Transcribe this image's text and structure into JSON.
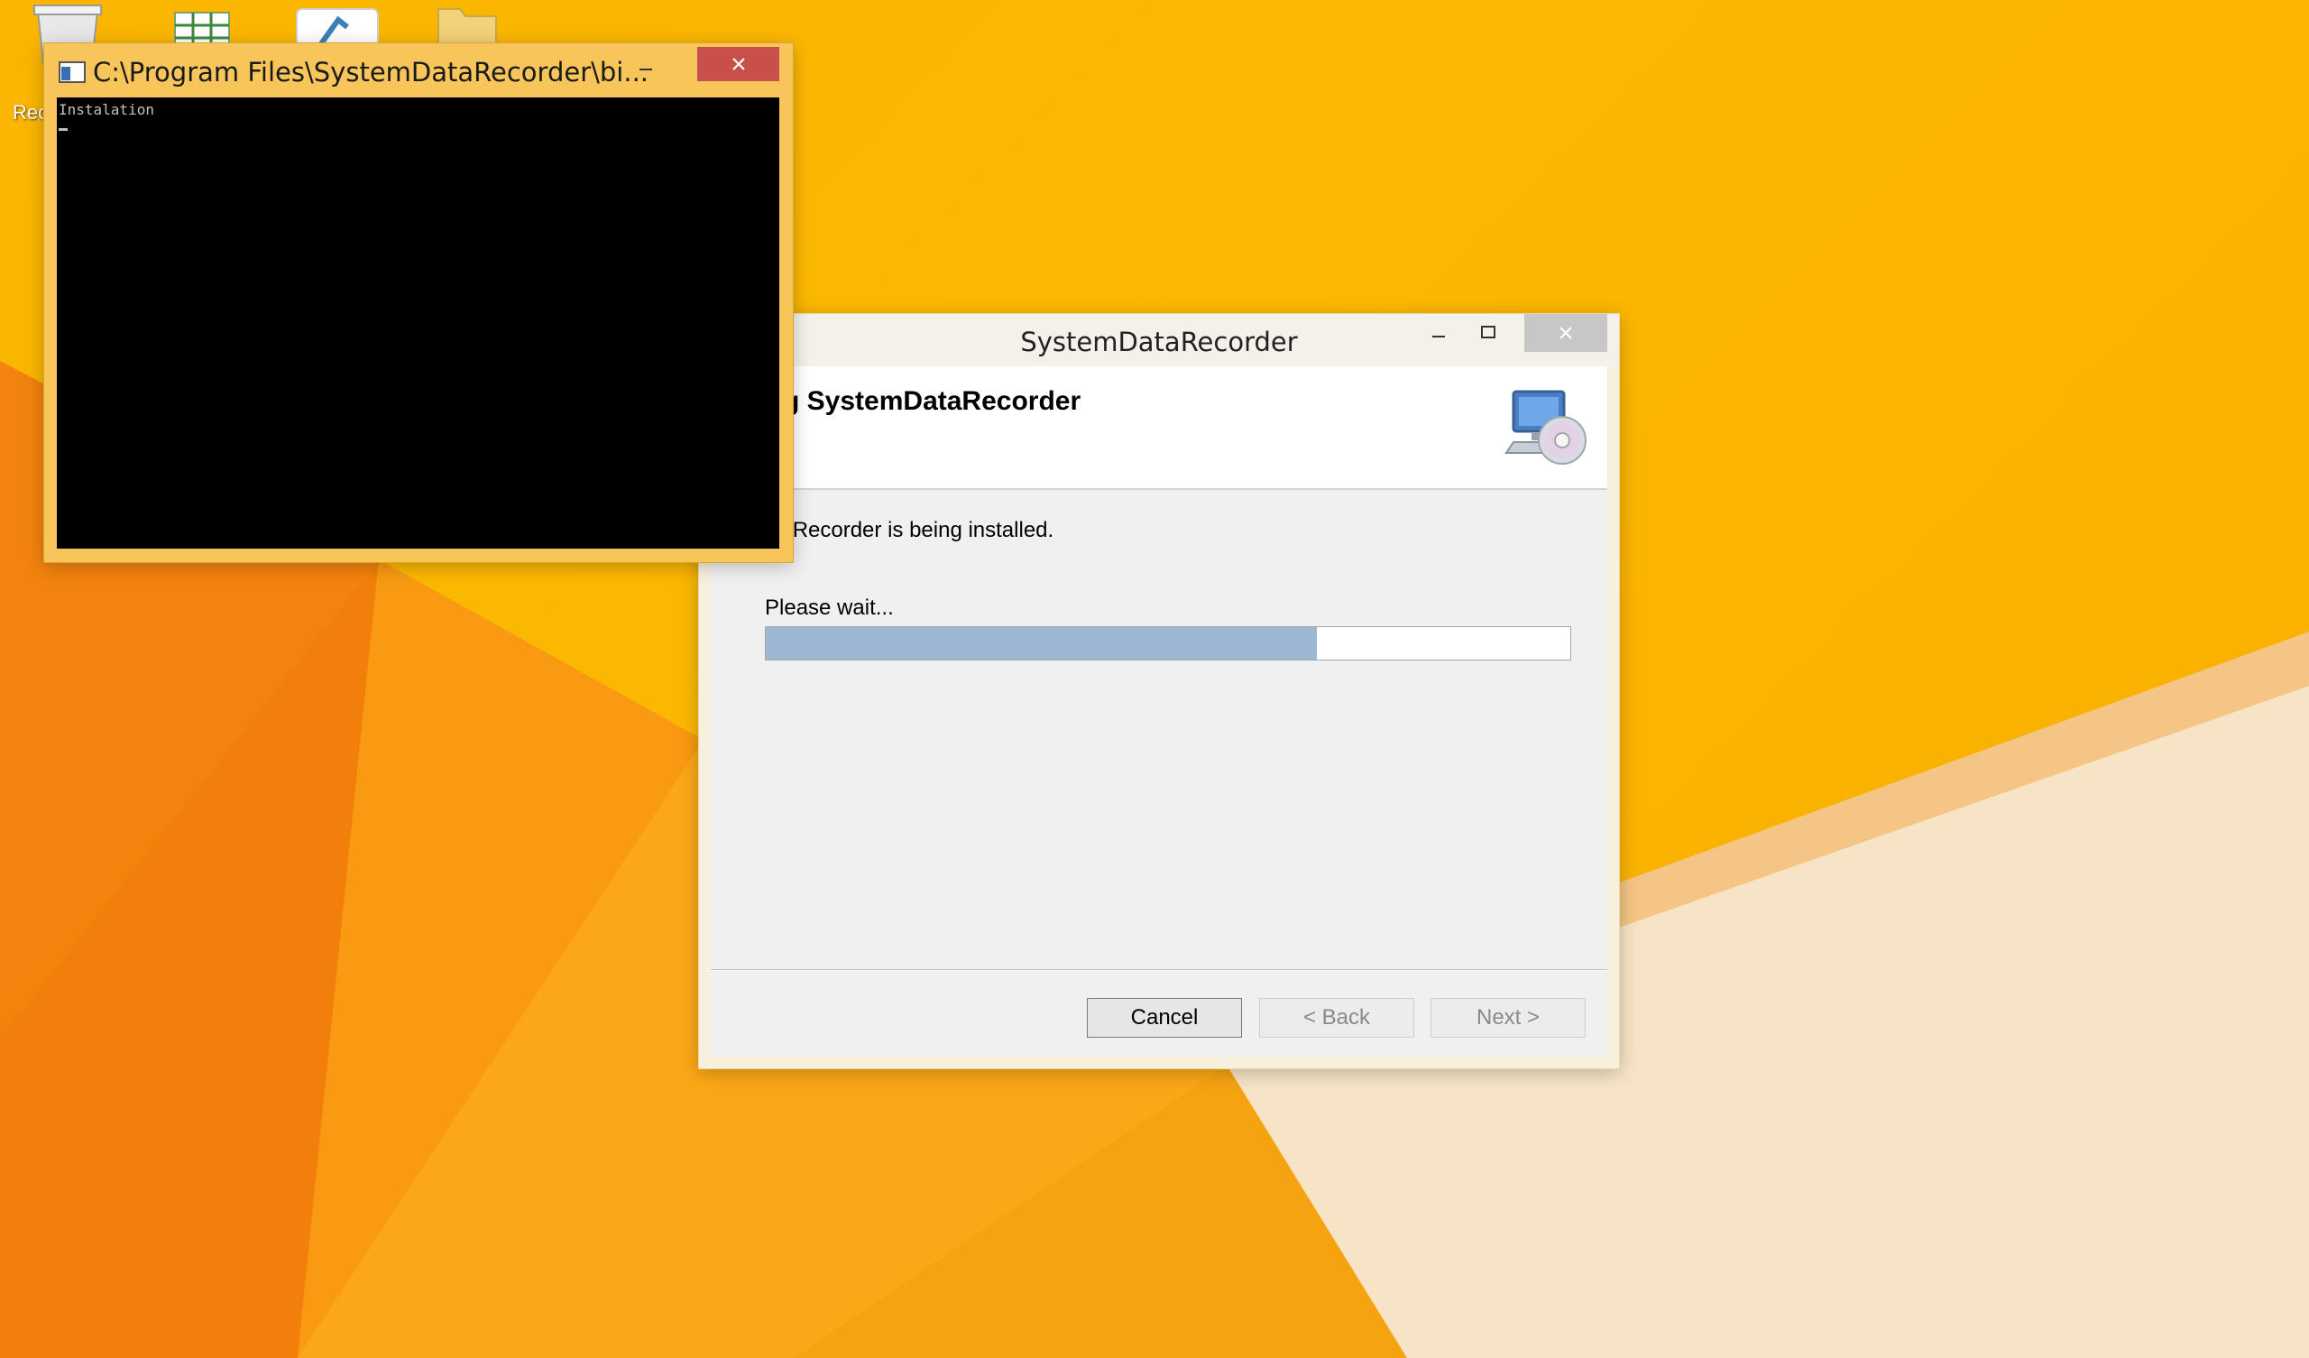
{
  "desktop": {
    "icons": [
      {
        "name": "recycle-bin-icon",
        "label": "Rec"
      },
      {
        "name": "spreadsheet-icon",
        "label": ""
      },
      {
        "name": "shortcut-icon",
        "label": ""
      },
      {
        "name": "folder-icon",
        "label": ""
      }
    ]
  },
  "console": {
    "title": "C:\\Program Files\\SystemDataRecorder\\bi...",
    "output": "Instalation"
  },
  "installer": {
    "title": "SystemDataRecorder",
    "banner_title": "alling SystemDataRecorder",
    "status": "mDataRecorder is being installed.",
    "wait_label": "Please wait...",
    "progress_fraction": 0.685,
    "buttons": {
      "cancel": "Cancel",
      "back": "< Back",
      "next": "Next >"
    }
  },
  "colors": {
    "progress_fill": "#9cb6d4",
    "console_frame": "#f7c559",
    "close_red": "#c9504a"
  }
}
